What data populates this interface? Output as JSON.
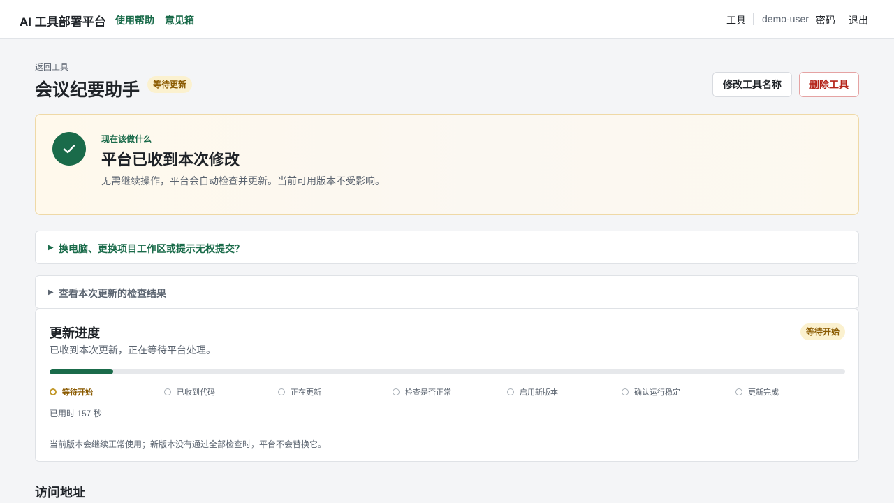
{
  "header": {
    "brand": "AI 工具部署平台",
    "nav": {
      "help": "使用帮助",
      "feedback": "意见箱"
    },
    "right": {
      "tools": "工具",
      "user": "demo-user",
      "password": "密码",
      "logout": "退出"
    }
  },
  "page": {
    "back_label": "返回工具",
    "title": "会议纪要助手",
    "status_badge": "等待更新",
    "rename_button": "修改工具名称",
    "delete_button": "删除工具"
  },
  "next_step": {
    "kicker": "现在该做什么",
    "title": "平台已收到本次修改",
    "description": "无需继续操作，平台会自动检查并更新。当前可用版本不受影响。",
    "icon": "check-icon"
  },
  "collapsibles": [
    {
      "label": "换电脑、更换项目工作区或提示无权提交？",
      "icon": "triangle-right-icon"
    },
    {
      "label": "查看本次更新的检查结果",
      "icon": "triangle-right-icon"
    }
  ],
  "progress": {
    "title": "更新进度",
    "description": "已收到本次更新，正在等待平台处理。",
    "status_badge": "等待开始",
    "fraction": 0.08,
    "steps": [
      {
        "label": "等待开始",
        "active": true
      },
      {
        "label": "已收到代码",
        "active": false
      },
      {
        "label": "正在更新",
        "active": false
      },
      {
        "label": "检查是否正常",
        "active": false
      },
      {
        "label": "启用新版本",
        "active": false
      },
      {
        "label": "确认运行稳定",
        "active": false
      },
      {
        "label": "更新完成",
        "active": false
      }
    ],
    "elapsed": "已用时 157 秒",
    "note": "当前版本会继续正常使用；新版本没有通过全部检查时，平台不会替换它。"
  },
  "access": {
    "title": "访问地址"
  },
  "colors": {
    "accent": "#1a6b4a",
    "warning_bg": "#fbf1cf",
    "warning_text": "#8a5a00",
    "danger": "#b42318"
  }
}
